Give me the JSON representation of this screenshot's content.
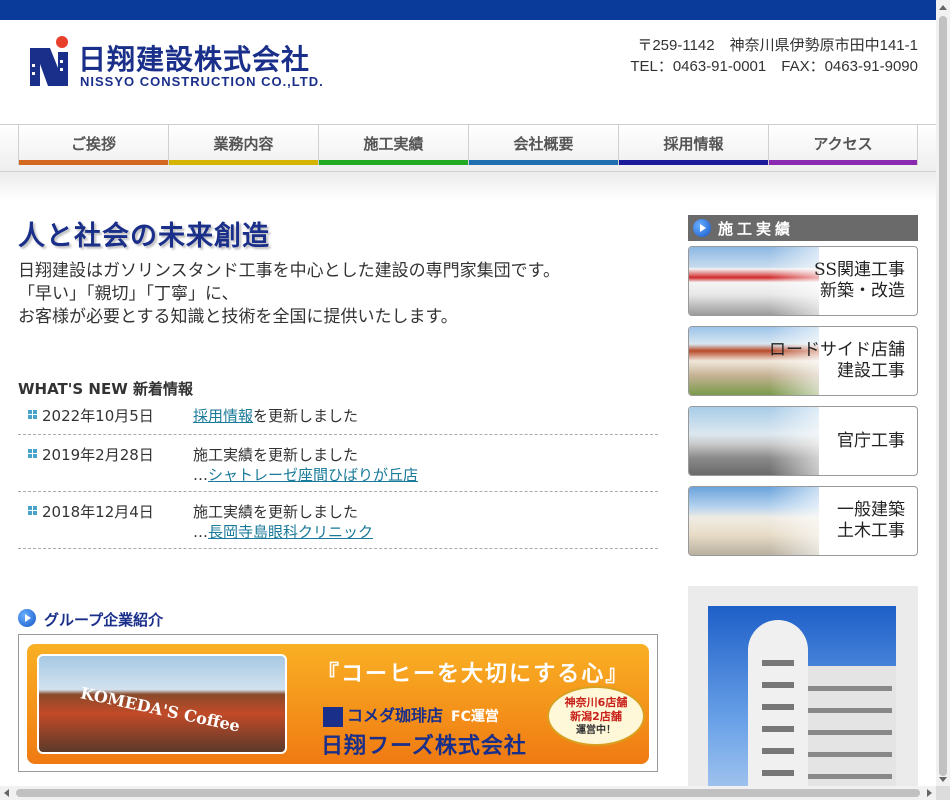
{
  "header": {
    "logo_jp": "日翔建設株式会社",
    "logo_en": "NISSYO CONSTRUCTION CO.,LTD.",
    "address": "〒259-1142　神奈川県伊勢原市田中141-1",
    "contact": "TEL：0463-91-0001　FAX：0463-91-9090"
  },
  "nav": {
    "items": [
      {
        "label": "ご挨拶",
        "color": "#d2691e"
      },
      {
        "label": "業務内容",
        "color": "#d4b400"
      },
      {
        "label": "施工実績",
        "color": "#22aa22"
      },
      {
        "label": "会社概要",
        "color": "#1f6fb0"
      },
      {
        "label": "採用情報",
        "color": "#1a1a9a"
      },
      {
        "label": "アクセス",
        "color": "#8a2ab0"
      }
    ]
  },
  "main": {
    "catch": "人と社会の未来創造",
    "intro": [
      "日翔建設はガソリンスタンド工事を中心とした建設の専門家集団です。",
      "「早い」「親切」「丁寧」に、",
      "お客様が必要とする知識と技術を全国に提供いたします。"
    ]
  },
  "news": {
    "heading": "WHAT'S NEW 新着情報",
    "items": [
      {
        "date": "2022年10月5日",
        "link": "採用情報",
        "text": "を更新しました"
      },
      {
        "date": "2019年2月28日",
        "text": "施工実績を更新しました",
        "prefix": "…",
        "link": "シャトレーゼ座間ひばりが丘店"
      },
      {
        "date": "2018年12月4日",
        "text": "施工実績を更新しました",
        "prefix": "…",
        "link": "長岡寺島眼科クリニック"
      }
    ]
  },
  "group": {
    "heading": "グループ企業紹介",
    "banner": {
      "photo_sign": "KOMEDA'S Coffee",
      "catch": "『コーヒーを大切にする心』",
      "fc_name": "コメダ珈琲店",
      "fc_text": "FC運営",
      "company": "日翔フーズ株式会社",
      "badge_line1": "神奈川6店舗",
      "badge_line2": "新潟2店舗",
      "badge_line3": "運営中！"
    }
  },
  "sidebar": {
    "heading": "施工実績",
    "buttons": [
      {
        "line1": "SS関連工事",
        "line2": "新築・改造"
      },
      {
        "line1": "ロードサイド店舗",
        "line2": "建設工事"
      },
      {
        "line1": "官庁工事",
        "line2": ""
      },
      {
        "line1": "一般建築",
        "line2": "土木工事"
      }
    ]
  },
  "colors": {
    "topbar": "#0a3a9a",
    "brand": "#1a2f8a",
    "link": "#1a7a9a"
  }
}
